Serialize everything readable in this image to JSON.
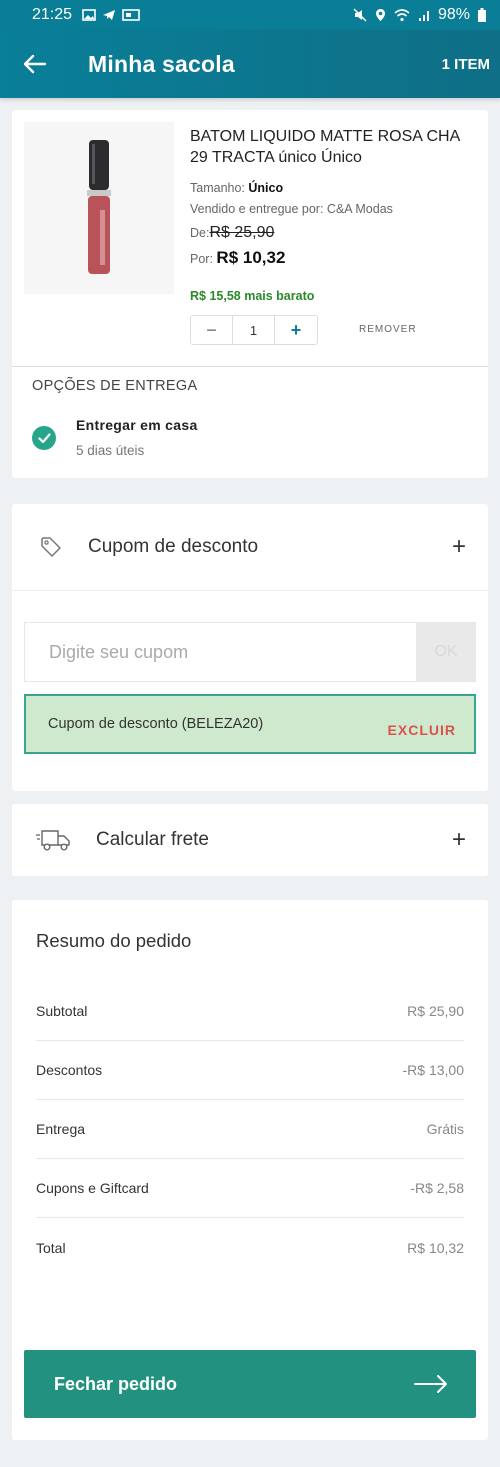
{
  "status": {
    "time": "21:25",
    "battery": "98%"
  },
  "header": {
    "title": "Minha sacola",
    "count": "1 ITEM"
  },
  "product": {
    "name": "BATOM LIQUIDO MATTE ROSA CHA 29 TRACTA  único Único",
    "size_label": "Tamanho:",
    "size_value": "Único",
    "seller": "Vendido e entregue por: C&A Modas",
    "from_label": "De:",
    "old_price": "R$  25,90",
    "by_label": "Por:",
    "new_price": "R$  10,32",
    "saving": "R$  15,58 mais barato",
    "quantity": "1",
    "remove_label": "REMOVER"
  },
  "delivery": {
    "title": "OPÇÕES DE ENTREGA",
    "option": "Entregar em casa",
    "eta": "5 dias úteis"
  },
  "coupon": {
    "title": "Cupom de desconto",
    "placeholder": "Digite seu cupom",
    "ok_label": "OK",
    "applied_text": "Cupom de desconto (BELEZA20)",
    "remove_label": "EXCLUIR"
  },
  "shipping": {
    "title": "Calcular frete"
  },
  "summary": {
    "title": "Resumo do pedido",
    "rows": [
      {
        "label": "Subtotal",
        "value": "R$ 25,90"
      },
      {
        "label": "Descontos",
        "value": "-R$ 13,00"
      },
      {
        "label": "Entrega",
        "value": "Grátis"
      },
      {
        "label": "Cupons e Giftcard",
        "value": "-R$ 2,58"
      },
      {
        "label": "Total",
        "value": "R$ 10,32"
      }
    ]
  },
  "checkout": {
    "label": "Fechar pedido"
  },
  "colors": {
    "primary": "#0a7f99",
    "accent": "#23917f",
    "success": "#2a8a2a",
    "danger": "#d9534f"
  }
}
